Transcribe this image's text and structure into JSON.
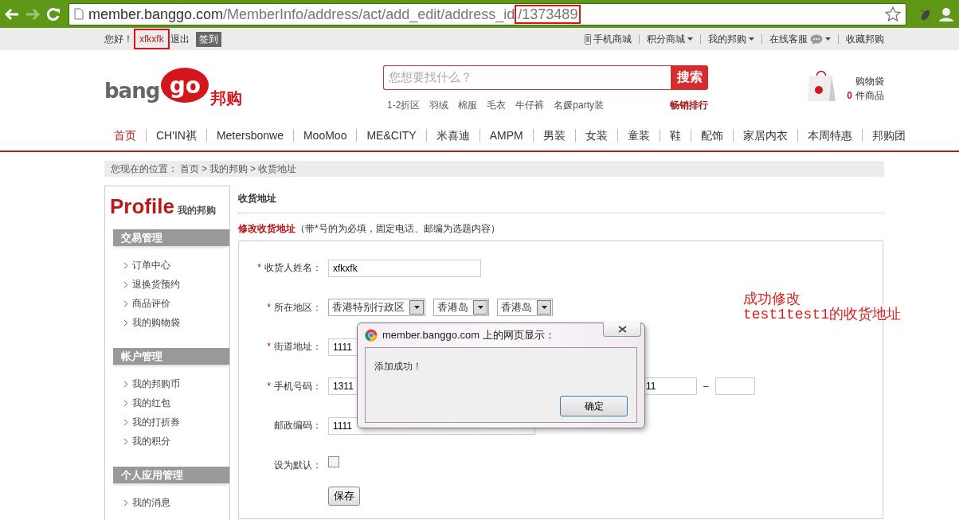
{
  "browser": {
    "url_host": "member.banggo.com",
    "url_path": "/MemberInfo/address/act/add_edit/address_id",
    "url_id": "/1373489",
    "url_id_highlighted": true
  },
  "topbar": {
    "greeting": "您好！",
    "username": "xfkxfk",
    "username_highlighted": true,
    "logout": "退出",
    "signin": "签到",
    "links": [
      {
        "label": "手机商城",
        "kind": "phone"
      },
      {
        "label": "积分商城",
        "kind": "dropdown"
      },
      {
        "label": "我的邦购",
        "kind": "dropdown"
      },
      {
        "label": "在线客服",
        "kind": "chat"
      },
      {
        "label": "收藏邦购",
        "kind": "plain"
      }
    ]
  },
  "header": {
    "logo_text": "bang",
    "logo_bubble": "go",
    "logo_cn": "邦购",
    "search_placeholder": "您想要找什么？",
    "search_button": "搜索",
    "hot_words": [
      "1-2折区",
      "羽绒",
      "棉服",
      "毛衣",
      "牛仔裤",
      "名媛party装"
    ],
    "bestseller": "畅销排行",
    "cart_title": "购物袋",
    "cart_count": "0",
    "cart_unit": "件商品"
  },
  "nav": [
    {
      "label": "首页",
      "selected": true
    },
    {
      "label": "CH'IN祺",
      "selected": false
    },
    {
      "label": "Metersbonwe",
      "selected": false
    },
    {
      "label": "MooMoo",
      "selected": false
    },
    {
      "label": "ME&CITY",
      "selected": false
    },
    {
      "label": "米喜迪",
      "selected": false
    },
    {
      "label": "AMPM",
      "selected": false
    },
    {
      "label": "男装",
      "selected": false
    },
    {
      "label": "女装",
      "selected": false
    },
    {
      "label": "童装",
      "selected": false
    },
    {
      "label": "鞋",
      "selected": false
    },
    {
      "label": "配饰",
      "selected": false
    },
    {
      "label": "家居内衣",
      "selected": false
    },
    {
      "label": "本周特惠",
      "selected": false
    },
    {
      "label": "邦购团",
      "selected": false
    }
  ],
  "breadcrumb": {
    "label": "您现在的位置：",
    "separator": ">",
    "items": [
      "首页",
      "我的邦购",
      "收货地址"
    ]
  },
  "sidebar": {
    "title": "Profile",
    "subtitle": "我的邦购",
    "groups": [
      {
        "title": "交易管理",
        "items": [
          "订单中心",
          "退换货预约",
          "商品评价",
          "我的购物袋"
        ]
      },
      {
        "title": "帐户管理",
        "items": [
          "我的邦购币",
          "我的红包",
          "我的打折券",
          "我的积分"
        ]
      },
      {
        "title": "个人应用管理",
        "items": [
          "我的消息"
        ]
      }
    ]
  },
  "form": {
    "heading": "收货地址",
    "edit_title": "修改收货地址",
    "note": "（带*号的为必填，固定电话、邮编为选题内容）",
    "rows": [
      {
        "kind": "text",
        "marker": "*",
        "label": "收货人姓名：",
        "value": "xfkxfk"
      },
      {
        "kind": "selects",
        "marker": "*",
        "label": "所在地区：",
        "selects": [
          "香港特别行政区",
          "香港岛",
          "香港岛"
        ]
      },
      {
        "kind": "text",
        "marker": "*",
        "label": "街道地址：",
        "value": "1111"
      },
      {
        "kind": "phone",
        "marker": "*",
        "label": "手机号码：",
        "value": "1311",
        "landline": "11",
        "separator": "–"
      },
      {
        "kind": "text",
        "label": "邮政编码：",
        "value": "1111"
      },
      {
        "kind": "checkbox",
        "label": "设为默认：",
        "checked": false
      }
    ],
    "save_button": "保存"
  },
  "annotation": {
    "lines": [
      "成功修改",
      "test1test1的收货地址"
    ]
  },
  "dialog": {
    "title": "member.banggo.com 上的网页显示：",
    "message": "添加成功！",
    "ok_button": "确定"
  }
}
